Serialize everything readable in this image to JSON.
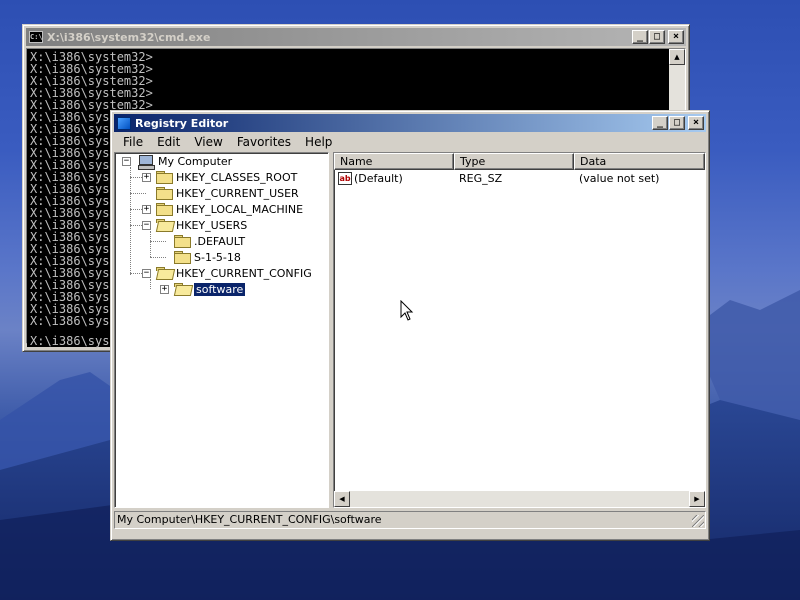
{
  "desktop": {
    "colors": {
      "sky": "#3a5cc0",
      "mountain": "#1b3378"
    }
  },
  "cmd_window": {
    "title": "X:\\i386\\system32\\cmd.exe",
    "lines": [
      "X:\\i386\\system32>",
      "X:\\i386\\system32>",
      "X:\\i386\\system32>",
      "X:\\i386\\system32>",
      "X:\\i386\\system32>",
      "X:\\i386\\sys",
      "X:\\i386\\sys",
      "X:\\i386\\sys",
      "X:\\i386\\sys",
      "X:\\i386\\sys",
      "X:\\i386\\sys",
      "X:\\i386\\sys",
      "X:\\i386\\sys",
      "X:\\i386\\sys",
      "X:\\i386\\sys",
      "X:\\i386\\sys",
      "X:\\i386\\sys",
      "X:\\i386\\sys",
      "X:\\i386\\sys",
      "X:\\i386\\sys",
      "X:\\i386\\sys",
      "X:\\i386\\sys",
      "X:\\i386\\sys"
    ],
    "last_line": "X:\\i386\\sys",
    "buttons": {
      "minimize": "_",
      "maximize": "□",
      "close": "×"
    }
  },
  "regedit": {
    "title": "Registry Editor",
    "buttons": {
      "minimize": "_",
      "maximize": "□",
      "close": "×"
    },
    "menu": [
      "File",
      "Edit",
      "View",
      "Favorites",
      "Help"
    ],
    "tree": {
      "root": "My Computer",
      "hkcr": "HKEY_CLASSES_ROOT",
      "hkcu": "HKEY_CURRENT_USER",
      "hklm": "HKEY_LOCAL_MACHINE",
      "hku": "HKEY_USERS",
      "hku_default": ".DEFAULT",
      "hku_s1518": "S-1-5-18",
      "hkcc": "HKEY_CURRENT_CONFIG",
      "hkcc_software": "software"
    },
    "columns": {
      "name": "Name",
      "type": "Type",
      "data": "Data"
    },
    "values": [
      {
        "name": "(Default)",
        "type": "REG_SZ",
        "data": "(value not set)"
      }
    ],
    "status": "My Computer\\HKEY_CURRENT_CONFIG\\software",
    "icons": {
      "value_icon": "ab"
    }
  }
}
